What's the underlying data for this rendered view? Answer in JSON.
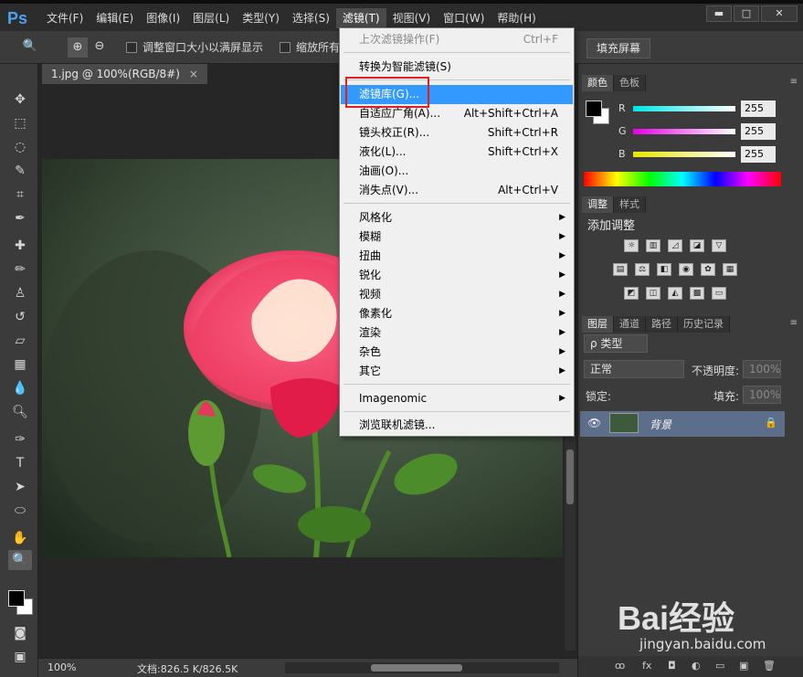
{
  "app": {
    "logo": "Ps"
  },
  "menubar": [
    {
      "label": "文件(F)"
    },
    {
      "label": "编辑(E)"
    },
    {
      "label": "图像(I)"
    },
    {
      "label": "图层(L)"
    },
    {
      "label": "类型(Y)"
    },
    {
      "label": "选择(S)"
    },
    {
      "label": "滤镜(T)"
    },
    {
      "label": "视图(V)"
    },
    {
      "label": "窗口(W)"
    },
    {
      "label": "帮助(H)"
    }
  ],
  "window_controls": {
    "minimize": "▬",
    "restore": "□",
    "close": "✕"
  },
  "options": {
    "fit_window_checkbox_label": "调整窗口大小以满屏显示",
    "zoom_all_checkbox_label": "缩放所有",
    "fill_screen_button": "填充屏幕"
  },
  "document": {
    "tab_title": "1.jpg @ 100%(RGB/8#)",
    "tab_close": "×",
    "zoom": "100%",
    "doc_info": "文档:826.5 K/826.5K"
  },
  "filter_menu": {
    "items": [
      {
        "label": "上次滤镜操作(F)",
        "shortcut": "Ctrl+F",
        "disabled": true
      },
      {
        "label": "转换为智能滤镜(S)",
        "shortcut": ""
      },
      {
        "label": "滤镜库(G)...",
        "shortcut": "",
        "highlighted": true
      },
      {
        "label": "自适应广角(A)...",
        "shortcut": "Alt+Shift+Ctrl+A"
      },
      {
        "label": "镜头校正(R)...",
        "shortcut": "Shift+Ctrl+R"
      },
      {
        "label": "液化(L)...",
        "shortcut": "Shift+Ctrl+X"
      },
      {
        "label": "油画(O)...",
        "shortcut": ""
      },
      {
        "label": "消失点(V)...",
        "shortcut": "Alt+Ctrl+V"
      },
      {
        "label": "风格化",
        "submenu": true
      },
      {
        "label": "模糊",
        "submenu": true
      },
      {
        "label": "扭曲",
        "submenu": true
      },
      {
        "label": "锐化",
        "submenu": true
      },
      {
        "label": "视频",
        "submenu": true
      },
      {
        "label": "像素化",
        "submenu": true
      },
      {
        "label": "渲染",
        "submenu": true
      },
      {
        "label": "杂色",
        "submenu": true
      },
      {
        "label": "其它",
        "submenu": true
      },
      {
        "label": "Imagenomic",
        "submenu": true
      },
      {
        "label": "浏览联机滤镜..."
      }
    ],
    "submenu_arrow": "▶"
  },
  "panels": {
    "color": {
      "tabs": [
        "颜色",
        "色板"
      ],
      "channels": [
        {
          "label": "R",
          "value": "255",
          "color": "#00e5e5"
        },
        {
          "label": "G",
          "value": "255",
          "color": "#e500e5"
        },
        {
          "label": "B",
          "value": "255",
          "color": "#e5e500"
        }
      ]
    },
    "adjustments": {
      "tabs": [
        "调整",
        "样式"
      ],
      "title": "添加调整"
    },
    "layers": {
      "tabs": [
        "图层",
        "通道",
        "路径",
        "历史记录"
      ],
      "filter_kind": "ρ 类型",
      "blend_mode": "正常",
      "opacity_label": "不透明度:",
      "opacity_value": "100%",
      "lock_label": "锁定:",
      "fill_label": "填充:",
      "fill_value": "100%",
      "layer_name": "背景",
      "footer_icons": [
        "ꝏ",
        "fx",
        "◘",
        "◐",
        "▭",
        "▣",
        "🗑"
      ]
    }
  },
  "watermark": {
    "main": "Bai经验",
    "sub": "jingyan.baidu.com"
  }
}
